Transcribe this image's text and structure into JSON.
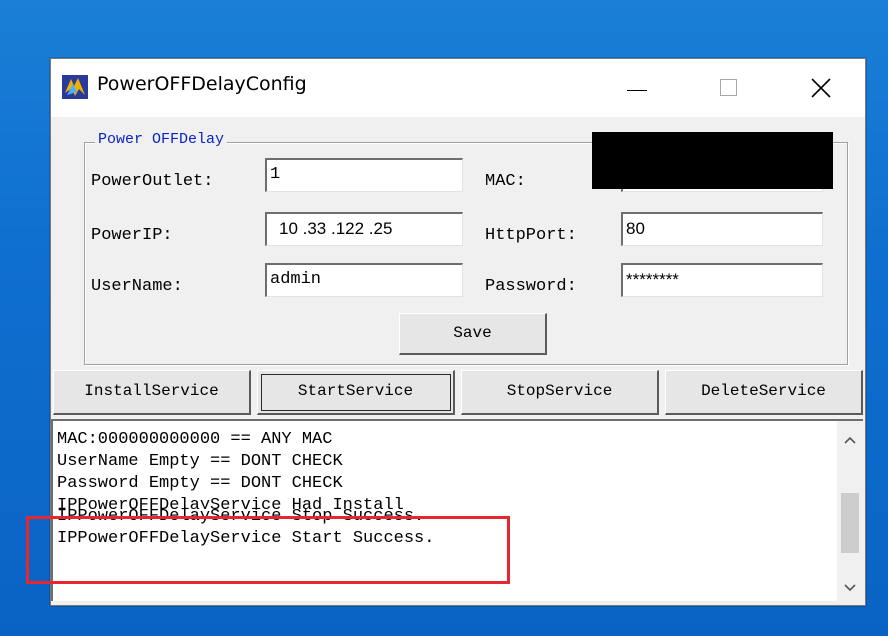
{
  "window": {
    "title": "PowerOFFDelayConfig"
  },
  "titlebar": {
    "minimize": "minimize",
    "maximize": "maximize",
    "close": "close"
  },
  "group": {
    "title": "Power OFFDelay",
    "power_outlet_label": "PowerOutlet:",
    "power_outlet_value": "1",
    "mac_label": "MAC:",
    "mac_value": "",
    "power_ip_label": "PowerIP:",
    "power_ip_value": "10 .33 .122 .25",
    "http_port_label": "HttpPort:",
    "http_port_value": "80",
    "username_label": "UserName:",
    "username_value": "admin",
    "password_label": "Password:",
    "password_value": "********",
    "save_label": "Save"
  },
  "service_buttons": {
    "install": "InstallService",
    "start": "StartService",
    "stop": "StopService",
    "delete": "DeleteService"
  },
  "log": {
    "lines": [
      "MAC:000000000000 == ANY MAC",
      "UserName Empty == DONT CHECK",
      "Password Empty == DONT CHECK",
      "IPPowerOFFDelayService Had Install",
      "IPPowerOFFDelayService Stop Success.",
      "IPPowerOFFDelayService Start Success."
    ]
  },
  "colors": {
    "highlight": "#e8262f",
    "group_title": "#0a23c8",
    "desktop": "#0f6fd0"
  }
}
